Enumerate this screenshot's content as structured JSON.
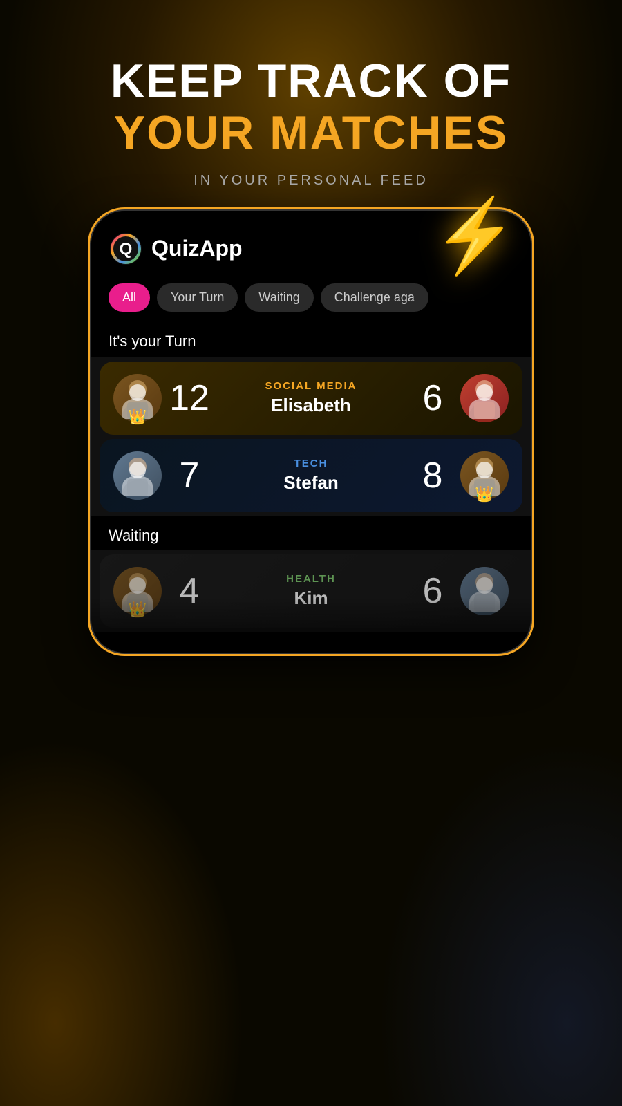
{
  "hero": {
    "line1": "KEEP TRACK OF",
    "line2": "YOUR MATCHES",
    "subtitle": "IN YOUR PERSONAL FEED"
  },
  "app": {
    "name": "QuizApp"
  },
  "tabs": [
    {
      "label": "All",
      "state": "active"
    },
    {
      "label": "Your Turn",
      "state": "inactive"
    },
    {
      "label": "Waiting",
      "state": "inactive"
    },
    {
      "label": "Challenge aga",
      "state": "inactive"
    }
  ],
  "sections": {
    "your_turn_label": "It's your Turn",
    "waiting_label": "Waiting"
  },
  "matches": {
    "your_turn": [
      {
        "player_score": "12",
        "category": "SOCIAL MEDIA",
        "category_color": "orange",
        "opponent_name": "Elisabeth",
        "opponent_score": "6",
        "player_has_crown": true,
        "opponent_has_crown": false
      }
    ],
    "waiting": [
      {
        "player_score": "7",
        "category": "TECH",
        "category_color": "blue",
        "opponent_name": "Stefan",
        "opponent_score": "8",
        "player_has_crown": false,
        "opponent_has_crown": true
      }
    ],
    "waiting_preview": [
      {
        "player_score": "4",
        "category": "HEALTH",
        "category_color": "green",
        "opponent_name": "Kim",
        "opponent_score": "6",
        "player_has_crown": false,
        "opponent_has_crown": false
      }
    ]
  },
  "lightning_emoji": "⚡",
  "colors": {
    "brand_orange": "#f5a623",
    "brand_pink": "#e91e8c",
    "bg_dark": "#0a0800"
  }
}
